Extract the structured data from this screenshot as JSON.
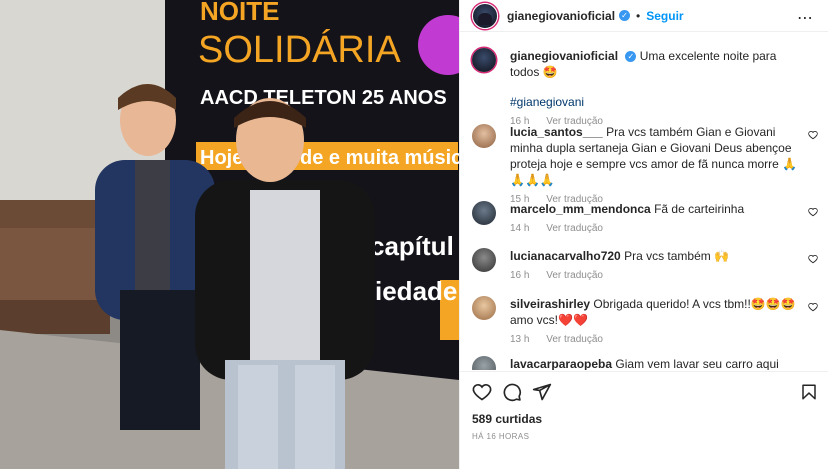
{
  "post": {
    "author": "gianegiovanioficial",
    "separator": "•",
    "follow_label": "Seguir",
    "more_icon": "⋯",
    "caption": "Uma excelente noite para todos 🤩",
    "hashtag": "#gianegiovani",
    "caption_time": "16 h",
    "translate_label": "Ver tradução",
    "likes": "589 curtidas",
    "time_ago": "HÁ 16 HORAS"
  },
  "photo": {
    "banner_line1": "NOITE",
    "banner_line2": "SOLIDÁRIA",
    "banner_line3": "AACD TELETON 25 ANOS",
    "banner_line4": "Hoje é dia de e muita música",
    "banner_line5": "capítul",
    "banner_line6": "iedade."
  },
  "comments": [
    {
      "user": "lucia_santos___",
      "text": "Pra vcs também Gian e Giovani minha dupla sertaneja Gian e Giovani Deus abençoe proteja hoje e sempre vcs amor de fã nunca morre 🙏🙏🙏🙏",
      "time": "15 h",
      "translate": "Ver tradução"
    },
    {
      "user": "marcelo_mm_mendonca",
      "text": "Fã de carteirinha",
      "time": "14 h",
      "translate": "Ver tradução"
    },
    {
      "user": "lucianacarvalho720",
      "text": "Pra vcs também 🙌",
      "time": "16 h",
      "translate": "Ver tradução"
    },
    {
      "user": "silveirashirley",
      "text": "Obrigada querido! A vcs tbm!!🤩🤩🤩 amo vcs!❤️❤️",
      "time": "13 h",
      "translate": "Ver tradução"
    },
    {
      "user": "lavacarparaopeba",
      "text": "Giam vem lavar seu carro aqui em",
      "time": "",
      "translate": ""
    }
  ],
  "colors": {
    "accent": "#0095f6",
    "verified": "#3897f0",
    "banner_orange": "#f4a523",
    "banner_purple": "#c13ad1"
  }
}
